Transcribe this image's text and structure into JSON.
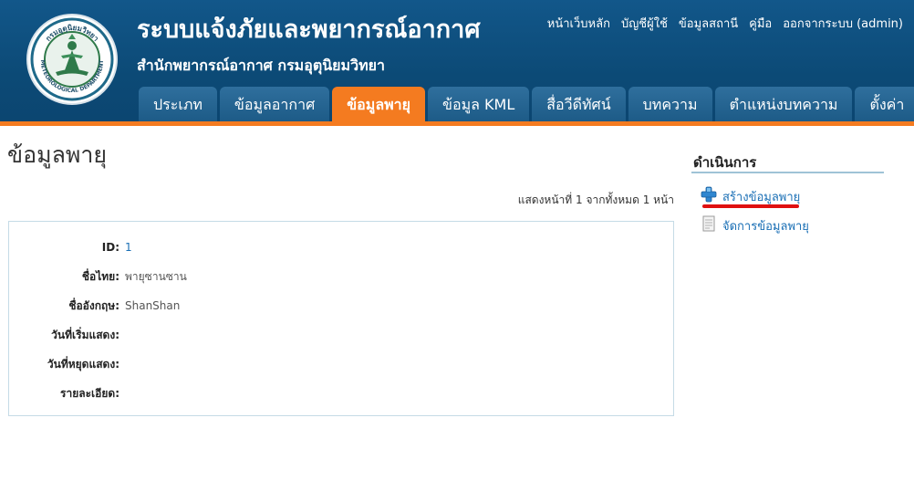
{
  "header": {
    "title": "ระบบแจ้งภัยและพยากรณ์อากาศ",
    "subtitle": "สำนักพยากรณ์อากาศ กรมอุตุนิยมวิทยา",
    "logo": {
      "top_text": "กรมอุตุนิยมวิทยา",
      "bottom_text": "METEOROLOGICAL DEPARTMENT"
    },
    "top_links": [
      "หน้าเว็บหลัก",
      "บัญชีผู้ใช้",
      "ข้อมูลสถานี",
      "คู่มือ",
      "ออกจากระบบ (admin)"
    ],
    "nav_tabs": [
      "ประเภท",
      "ข้อมูลอากาศ",
      "ข้อมูลพายุ",
      "ข้อมูล KML",
      "สื่อวีดีทัศน์",
      "บทความ",
      "ตำแหน่งบทความ",
      "ตั้งค่า"
    ],
    "active_tab": "ข้อมูลพายุ"
  },
  "main": {
    "page_title": "ข้อมูลพายุ",
    "pager": "แสดงหน้าที่ 1 จากทั้งหมด 1 หน้า",
    "details": [
      {
        "label": "ID:",
        "value": "1"
      },
      {
        "label": "ชื่อไทย:",
        "value": "พายุซานซาน"
      },
      {
        "label": "ชื่ออังกฤษ:",
        "value": "ShanShan"
      },
      {
        "label": "วันที่เริ่มแสดง:",
        "value": ""
      },
      {
        "label": "วันที่หยุดแสดง:",
        "value": ""
      },
      {
        "label": "รายละเอียด:",
        "value": ""
      }
    ]
  },
  "sidebar": {
    "title": "ดำเนินการ",
    "items": [
      {
        "label": "สร้างข้อมูลพายุ",
        "icon": "plus-icon"
      },
      {
        "label": "จัดการข้อมูลพายุ",
        "icon": "document-icon"
      }
    ]
  },
  "colors": {
    "header_bg": "#0e4f7c",
    "accent": "#f47b20",
    "link": "#1a6fb5",
    "highlight": "#e01010"
  }
}
